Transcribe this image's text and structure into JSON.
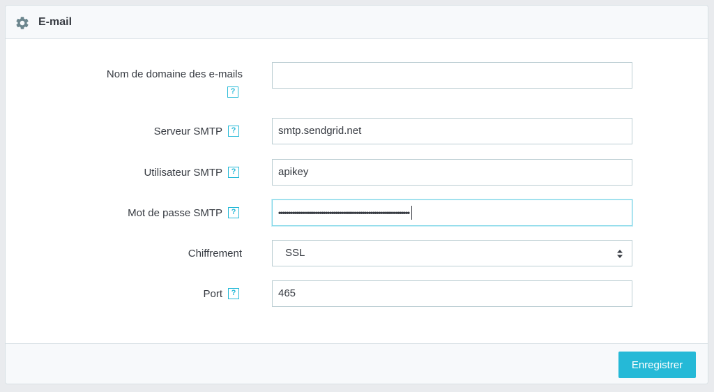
{
  "panel": {
    "title": "E-mail",
    "icon": "gear-icon"
  },
  "fields": {
    "domain": {
      "label": "Nom de domaine des e-mails",
      "value": "",
      "help": "?"
    },
    "smtp_server": {
      "label": "Serveur SMTP",
      "value": "smtp.sendgrid.net",
      "help": "?"
    },
    "smtp_user": {
      "label": "Utilisateur SMTP",
      "value": "apikey",
      "help": "?"
    },
    "smtp_password": {
      "label": "Mot de passe SMTP",
      "value": "•••••••••••••••••••••••••••••••••••••••••••••••••••••••••••••••••••",
      "help": "?"
    },
    "encryption": {
      "label": "Chiffrement",
      "selected": "SSL"
    },
    "port": {
      "label": "Port",
      "value": "465",
      "help": "?"
    }
  },
  "footer": {
    "save_label": "Enregistrer"
  },
  "colors": {
    "accent": "#25b9d7",
    "border": "#bbcdd2",
    "text": "#363a41"
  }
}
